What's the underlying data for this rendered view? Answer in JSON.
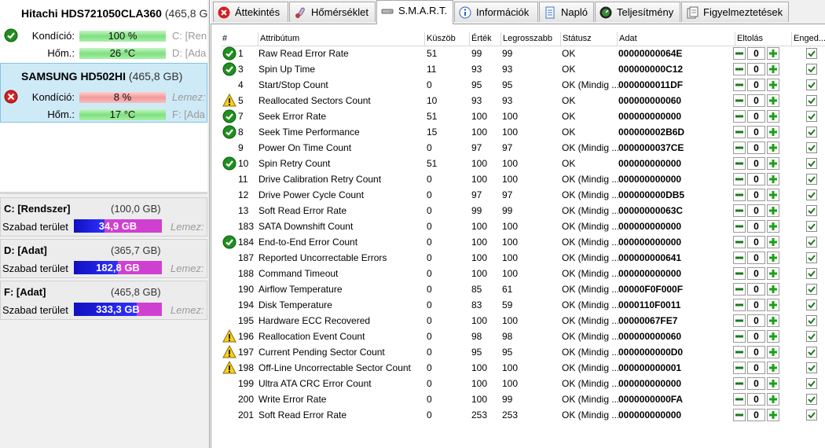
{
  "disks": [
    {
      "name": "Hitachi HDS721050CLA360",
      "size": "(465,8 G",
      "health_label": "Kondíció:",
      "health_value": "100 %",
      "health_state": "ok",
      "health_extra": "C: [Ren",
      "temp_label": "Hőm.:",
      "temp_value": "26 °C",
      "temp_extra": "D: [Ada"
    },
    {
      "name": "SAMSUNG HD502HI",
      "size": "(465,8 GB)",
      "health_label": "Kondíció:",
      "health_value": "8 %",
      "health_state": "bad",
      "health_extra": "Lemez:",
      "temp_label": "Hőm.:",
      "temp_value": "17 °C",
      "temp_extra": "F: [Ada"
    }
  ],
  "partitions": [
    {
      "name": "C: [Rendszer]",
      "size": "(100,0 GB)",
      "free_label": "Szabad terület",
      "free_value": "34,9 GB",
      "free_fraction": 0.349,
      "extra": "Lemez:"
    },
    {
      "name": "D: [Adat]",
      "size": "(365,7 GB)",
      "free_label": "Szabad terület",
      "free_value": "182,8 GB",
      "free_fraction": 0.5,
      "extra": "Lemez:"
    },
    {
      "name": "F: [Adat]",
      "size": "(465,8 GB)",
      "free_label": "Szabad terület",
      "free_value": "333,3 GB",
      "free_fraction": 0.716,
      "extra": "Lemez:"
    }
  ],
  "tabs": [
    {
      "label": "Áttekintés",
      "icon": "error-circle-icon",
      "active": false
    },
    {
      "label": "Hőmérséklet",
      "icon": "thermometer-icon",
      "active": false
    },
    {
      "label": "S.M.A.R.T.",
      "icon": "disk-drive-icon",
      "active": true
    },
    {
      "label": "Információk",
      "icon": "info-icon",
      "active": false
    },
    {
      "label": "Napló",
      "icon": "log-icon",
      "active": false
    },
    {
      "label": "Teljesítmény",
      "icon": "gauge-icon",
      "active": false
    },
    {
      "label": "Figyelmeztetések",
      "icon": "alerts-icon",
      "active": false
    }
  ],
  "table": {
    "headers": [
      "#",
      "Attribútum",
      "Küszöb",
      "Érték",
      "Legrosszabb",
      "Státusz",
      "Adat",
      "Eltolás",
      "Enged..."
    ],
    "rows": [
      {
        "icon": "ok",
        "id": "1",
        "attr": "Raw Read Error Rate",
        "threshold": "51",
        "value": "99",
        "worst": "99",
        "status": "OK",
        "data": "00000000064E",
        "offset": "0"
      },
      {
        "icon": "ok",
        "id": "3",
        "attr": "Spin Up Time",
        "threshold": "11",
        "value": "93",
        "worst": "93",
        "status": "OK",
        "data": "000000000C12",
        "offset": "0"
      },
      {
        "icon": "none",
        "id": "4",
        "attr": "Start/Stop Count",
        "threshold": "0",
        "value": "95",
        "worst": "95",
        "status": "OK (Mindig ...",
        "data": "0000000011DF",
        "offset": "0"
      },
      {
        "icon": "warn",
        "id": "5",
        "attr": "Reallocated Sectors Count",
        "threshold": "10",
        "value": "93",
        "worst": "93",
        "status": "OK",
        "data": "000000000060",
        "offset": "0"
      },
      {
        "icon": "ok",
        "id": "7",
        "attr": "Seek Error Rate",
        "threshold": "51",
        "value": "100",
        "worst": "100",
        "status": "OK",
        "data": "000000000000",
        "offset": "0"
      },
      {
        "icon": "ok",
        "id": "8",
        "attr": "Seek Time Performance",
        "threshold": "15",
        "value": "100",
        "worst": "100",
        "status": "OK",
        "data": "000000002B6D",
        "offset": "0"
      },
      {
        "icon": "none",
        "id": "9",
        "attr": "Power On Time Count",
        "threshold": "0",
        "value": "97",
        "worst": "97",
        "status": "OK (Mindig ...",
        "data": "0000000037CE",
        "offset": "0"
      },
      {
        "icon": "ok",
        "id": "10",
        "attr": "Spin Retry Count",
        "threshold": "51",
        "value": "100",
        "worst": "100",
        "status": "OK",
        "data": "000000000000",
        "offset": "0"
      },
      {
        "icon": "none",
        "id": "11",
        "attr": "Drive Calibration Retry Count",
        "threshold": "0",
        "value": "100",
        "worst": "100",
        "status": "OK (Mindig ...",
        "data": "000000000000",
        "offset": "0"
      },
      {
        "icon": "none",
        "id": "12",
        "attr": "Drive Power Cycle Count",
        "threshold": "0",
        "value": "97",
        "worst": "97",
        "status": "OK (Mindig ...",
        "data": "000000000DB5",
        "offset": "0"
      },
      {
        "icon": "none",
        "id": "13",
        "attr": "Soft Read Error Rate",
        "threshold": "0",
        "value": "99",
        "worst": "99",
        "status": "OK (Mindig ...",
        "data": "00000000063C",
        "offset": "0"
      },
      {
        "icon": "none",
        "id": "183",
        "attr": "SATA Downshift Count",
        "threshold": "0",
        "value": "100",
        "worst": "100",
        "status": "OK (Mindig ...",
        "data": "000000000000",
        "offset": "0"
      },
      {
        "icon": "ok",
        "id": "184",
        "attr": "End-to-End Error Count",
        "threshold": "0",
        "value": "100",
        "worst": "100",
        "status": "OK (Mindig ...",
        "data": "000000000000",
        "offset": "0"
      },
      {
        "icon": "none",
        "id": "187",
        "attr": "Reported Uncorrectable Errors",
        "threshold": "0",
        "value": "100",
        "worst": "100",
        "status": "OK (Mindig ...",
        "data": "000000000641",
        "offset": "0"
      },
      {
        "icon": "none",
        "id": "188",
        "attr": "Command Timeout",
        "threshold": "0",
        "value": "100",
        "worst": "100",
        "status": "OK (Mindig ...",
        "data": "000000000000",
        "offset": "0"
      },
      {
        "icon": "none",
        "id": "190",
        "attr": "Airflow Temperature",
        "threshold": "0",
        "value": "85",
        "worst": "61",
        "status": "OK (Mindig ...",
        "data": "00000F0F000F",
        "offset": "0"
      },
      {
        "icon": "none",
        "id": "194",
        "attr": "Disk Temperature",
        "threshold": "0",
        "value": "83",
        "worst": "59",
        "status": "OK (Mindig ...",
        "data": "0000110F0011",
        "offset": "0"
      },
      {
        "icon": "none",
        "id": "195",
        "attr": "Hardware ECC Recovered",
        "threshold": "0",
        "value": "100",
        "worst": "100",
        "status": "OK (Mindig ...",
        "data": "00000067FE7",
        "offset": "0"
      },
      {
        "icon": "warn",
        "id": "196",
        "attr": "Reallocation Event Count",
        "threshold": "0",
        "value": "98",
        "worst": "98",
        "status": "OK (Mindig ...",
        "data": "000000000060",
        "offset": "0"
      },
      {
        "icon": "warn",
        "id": "197",
        "attr": "Current Pending Sector Count",
        "threshold": "0",
        "value": "95",
        "worst": "95",
        "status": "OK (Mindig ...",
        "data": "0000000000D0",
        "offset": "0"
      },
      {
        "icon": "warn",
        "id": "198",
        "attr": "Off-Line Uncorrectable Sector Count",
        "threshold": "0",
        "value": "100",
        "worst": "100",
        "status": "OK (Mindig ...",
        "data": "000000000001",
        "offset": "0"
      },
      {
        "icon": "none",
        "id": "199",
        "attr": "Ultra ATA CRC Error Count",
        "threshold": "0",
        "value": "100",
        "worst": "100",
        "status": "OK (Mindig ...",
        "data": "000000000000",
        "offset": "0"
      },
      {
        "icon": "none",
        "id": "200",
        "attr": "Write Error Rate",
        "threshold": "0",
        "value": "100",
        "worst": "99",
        "status": "OK (Mindig ...",
        "data": "0000000000FA",
        "offset": "0"
      },
      {
        "icon": "none",
        "id": "201",
        "attr": "Soft Read Error Rate",
        "threshold": "0",
        "value": "253",
        "worst": "253",
        "status": "OK (Mindig ...",
        "data": "000000000000",
        "offset": "0"
      }
    ]
  },
  "colors": {
    "ok_green": "#1f8f1f",
    "bad_red": "#d42020",
    "warn_yellow": "#f5d020",
    "plus_green": "#1aa01a",
    "minus_green": "#1a7a1a"
  }
}
